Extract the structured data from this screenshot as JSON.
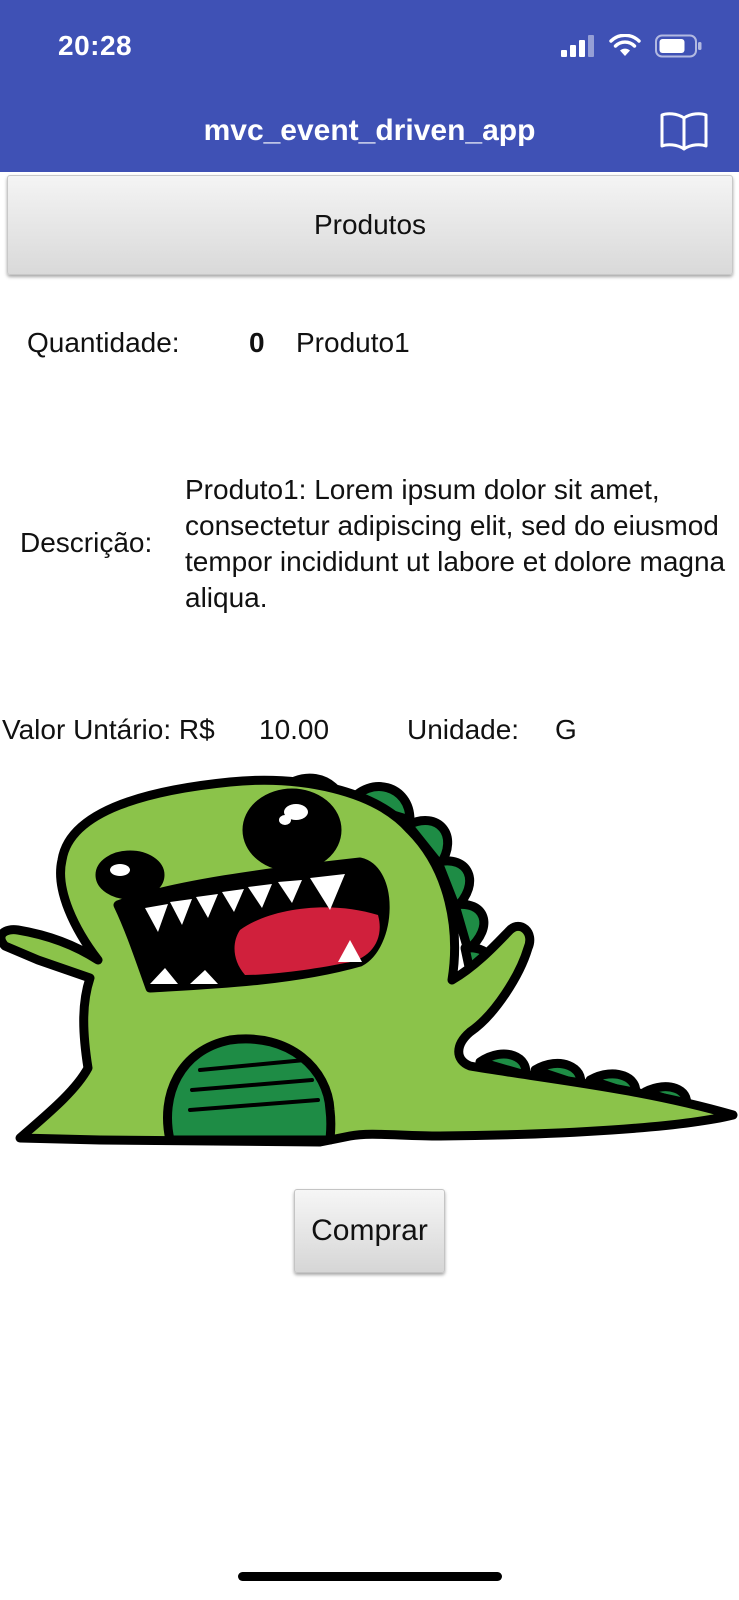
{
  "status_bar": {
    "time": "20:28"
  },
  "app_bar": {
    "title": "mvc_event_driven_app",
    "book_icon": "book-open-icon"
  },
  "products_button": {
    "label": "Produtos"
  },
  "product": {
    "quantity_label": "Quantidade:",
    "quantity_value": "0",
    "name": "Produto1",
    "description_label": "Descrição:",
    "description": "Produto1: Lorem ipsum dolor sit amet, consectetur adipiscing elit, sed do eiusmod tempor incididunt ut labore et dolore magna aliqua.",
    "unit_price_label": "Valor Untário: R$",
    "unit_price": "10.00",
    "unit_label": "Unidade:",
    "unit": "G",
    "image": "green-dinosaur-illustration"
  },
  "buy_button": {
    "label": "Comprar"
  },
  "colors": {
    "app_bar": "#3f51b5",
    "dino_body": "#8bc34a",
    "dino_spikes": "#1e8c45",
    "dino_tongue": "#d0203c"
  }
}
